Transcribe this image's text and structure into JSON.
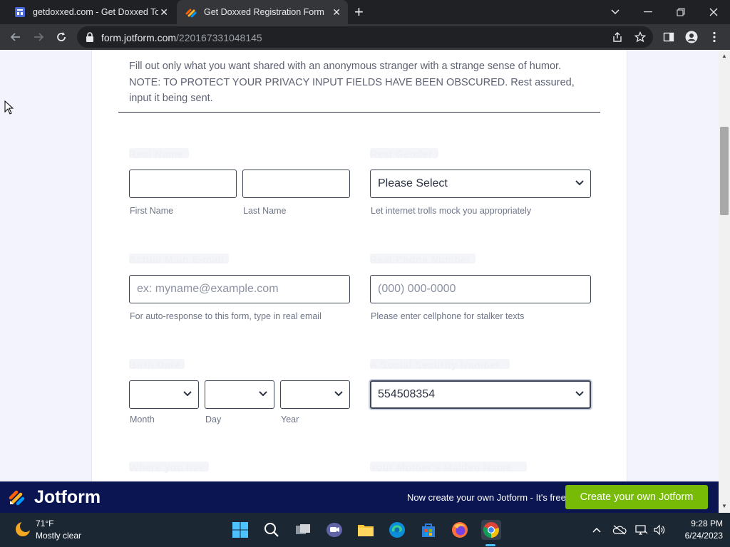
{
  "browser": {
    "tabs": [
      {
        "title": "getdoxxed.com - Get Doxxed Today",
        "active": false
      },
      {
        "title": "Get Doxxed Registration Form",
        "active": true
      }
    ],
    "new_tab_label": "+",
    "url_domain": "form.jotform.com",
    "url_path": "/220167331048145"
  },
  "form": {
    "description": "Fill out only what you want shared with an anonymous stranger with a strange sense of humor. NOTE: TO PROTECT YOUR PRIVACY INPUT FIELDS HAVE BEEN OBSCURED. Rest assured, input it being sent.",
    "obscured_labels": {
      "real_name": "Real Name",
      "real_gender": "Real Gender",
      "actual_email": "Actual Main E-mail",
      "real_phone": "Real Phone Number",
      "birth_date": "Birth Date",
      "ssn": "A Social Security Number",
      "where_you_live": "Where you live",
      "mothers_maiden": "Your Mother's Maiden Name"
    },
    "first_name": {
      "value": "",
      "sublabel": "First Name"
    },
    "last_name": {
      "value": "",
      "sublabel": "Last Name"
    },
    "gender": {
      "value": "Please Select",
      "sublabel": "Let internet trolls mock you appropriately"
    },
    "email": {
      "placeholder": "ex: myname@example.com",
      "sublabel": "For auto-response to this form, type in real email"
    },
    "phone": {
      "placeholder": "(000) 000-0000",
      "sublabel": "Please enter cellphone for stalker texts"
    },
    "birth": {
      "month_label": "Month",
      "day_label": "Day",
      "year_label": "Year"
    },
    "ssn_value": "554508354"
  },
  "jotform_bar": {
    "brand": "Jotform",
    "tagline": "Now create your own Jotform - It's free!",
    "cta": "Create your own Jotform"
  },
  "taskbar": {
    "temperature": "71°F",
    "condition": "Mostly clear",
    "time": "9:28 PM",
    "date": "6/24/2023"
  },
  "colors": {
    "jotform_navy": "#0a1551",
    "cta_green": "#78bb07",
    "page_bg": "#f3f3fe"
  }
}
